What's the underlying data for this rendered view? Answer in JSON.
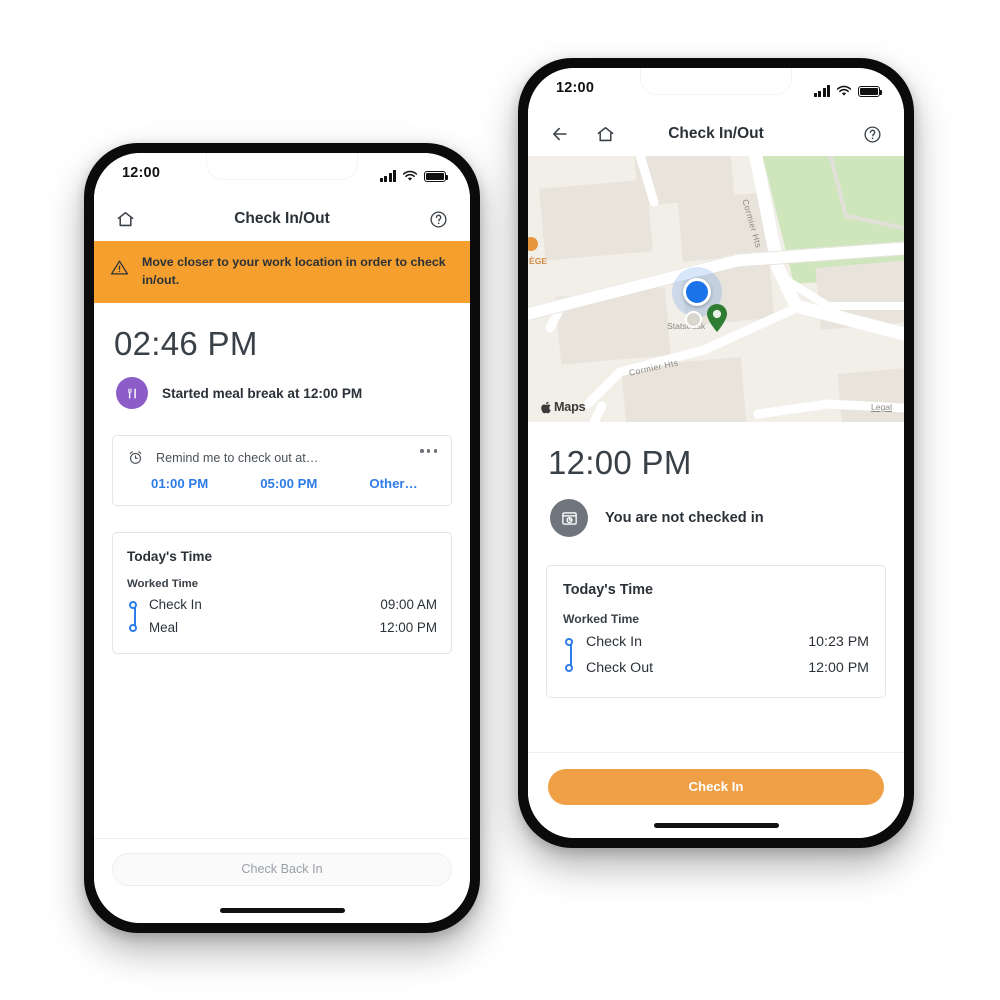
{
  "screens": {
    "left": {
      "status_bar": {
        "time": "12:00",
        "signal_icon": "cellular-signal-icon",
        "wifi_icon": "wifi-icon",
        "battery_icon": "battery-full-icon"
      },
      "nav": {
        "title": "Check In/Out",
        "home_icon": "home-icon",
        "help_icon": "question-circle-icon"
      },
      "banner": {
        "icon": "warning-triangle-icon",
        "text": "Move closer to your work location in order to check in/out.",
        "bg_color": "#F5A02E"
      },
      "clock": "02:46 PM",
      "status": {
        "icon": "meal-utensils-icon",
        "icon_color": "#8C5CC8",
        "text": "Started meal break at 12:00 PM"
      },
      "reminder_card": {
        "icon": "alarm-clock-icon",
        "label": "Remind me to check out at…",
        "menu_icon": "more-horizontal-icon",
        "options": [
          {
            "label": "01:00 PM"
          },
          {
            "label": "05:00 PM"
          },
          {
            "label": "Other…"
          }
        ],
        "link_color": "#2F7CE8"
      },
      "todays_time": {
        "title": "Today's Time",
        "subtitle": "Worked Time",
        "rows": [
          {
            "label": "Check In",
            "value": "09:00 AM"
          },
          {
            "label": "Meal",
            "value": "12:00 PM"
          }
        ]
      },
      "footer_button": {
        "label": "Check Back In",
        "enabled": false
      }
    },
    "right": {
      "status_bar": {
        "time": "12:00",
        "signal_icon": "cellular-signal-icon",
        "wifi_icon": "wifi-icon",
        "battery_icon": "battery-full-icon"
      },
      "nav": {
        "title": "Check In/Out",
        "back_icon": "arrow-left-icon",
        "home_icon": "home-icon",
        "help_icon": "question-circle-icon"
      },
      "map": {
        "attribution": "Maps",
        "apple_icon": "apple-logo-icon",
        "legal_link": "Legal",
        "user_location_icon": "blue-location-dot",
        "destination_pin_icon": "green-map-pin",
        "labels": [
          {
            "text": "Cormier Hts"
          },
          {
            "text": "Cormier Hts"
          },
          {
            "text": "Statstrask"
          },
          {
            "text": "ÈGE"
          }
        ]
      },
      "clock": "12:00 PM",
      "status": {
        "icon": "timecard-icon",
        "icon_color": "#6E757C",
        "text": "You are not checked in"
      },
      "todays_time": {
        "title": "Today's Time",
        "subtitle": "Worked Time",
        "rows": [
          {
            "label": "Check In",
            "value": "10:23 PM"
          },
          {
            "label": "Check Out",
            "value": "12:00 PM"
          }
        ]
      },
      "footer_button": {
        "label": "Check In",
        "enabled": true,
        "bg_color": "#EFA046"
      }
    }
  }
}
